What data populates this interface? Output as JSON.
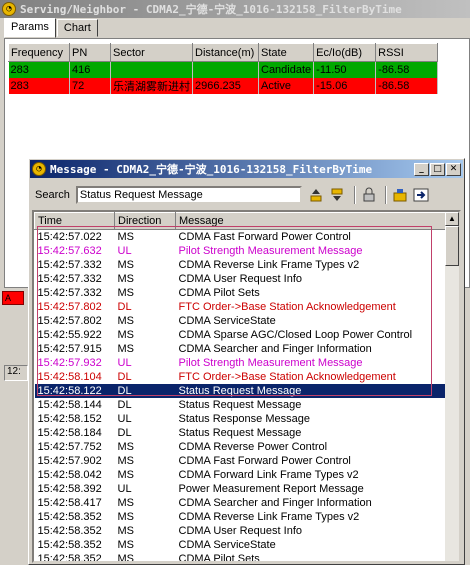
{
  "serving_window": {
    "title": "Serving/Neighbor - CDMA2_宁德-宁波_1016-132158_FilterByTime",
    "tabs": [
      "Params",
      "Chart"
    ],
    "columns": [
      "Frequency",
      "PN",
      "Sector",
      "Distance(m)",
      "State",
      "Ec/Io(dB)",
      "RSSI"
    ],
    "rows": [
      {
        "frequency": "283",
        "pn": "416",
        "sector": "",
        "distance": "",
        "state": "Candidate",
        "ecio": "-11.50",
        "rssi": "-86.58",
        "color": "#00a800"
      },
      {
        "frequency": "283",
        "pn": "72",
        "sector": "乐清湖雾新进村",
        "distance": "2966.235",
        "state": "Active",
        "ecio": "-15.06",
        "rssi": "-86.58",
        "color": "#ff0000"
      }
    ],
    "left_strip_text": "A",
    "left_box_text": "12:"
  },
  "message_window": {
    "title": "Message - CDMA2_宁德-宁波_1016-132158_FilterByTime",
    "search_label": "Search",
    "search_value": "Status Request Message",
    "columns": [
      "Time",
      "Direction",
      "Message"
    ],
    "rows": [
      {
        "time": "15:42:57.022",
        "dir": "MS",
        "msg": "CDMA Fast Forward Power Control",
        "color": "#000000"
      },
      {
        "time": "15:42:57.632",
        "dir": "UL",
        "msg": "Pilot Strength Measurement Message",
        "color": "#cc00cc"
      },
      {
        "time": "15:42:57.332",
        "dir": "MS",
        "msg": "CDMA Reverse Link Frame Types v2",
        "color": "#000000"
      },
      {
        "time": "15:42:57.332",
        "dir": "MS",
        "msg": "CDMA User Request Info",
        "color": "#000000"
      },
      {
        "time": "15:42:57.332",
        "dir": "MS",
        "msg": "CDMA Pilot Sets",
        "color": "#000000"
      },
      {
        "time": "15:42:57.802",
        "dir": "DL",
        "msg": "FTC Order->Base Station Acknowledgement",
        "color": "#cc0000"
      },
      {
        "time": "15:42:57.802",
        "dir": "MS",
        "msg": "CDMA ServiceState",
        "color": "#000000"
      },
      {
        "time": "15:42:55.922",
        "dir": "MS",
        "msg": "CDMA Sparse AGC/Closed Loop Power Control",
        "color": "#000000"
      },
      {
        "time": "15:42:57.915",
        "dir": "MS",
        "msg": "CDMA Searcher and Finger Information",
        "color": "#000000"
      },
      {
        "time": "15:42:57.932",
        "dir": "UL",
        "msg": "Pilot Strength Measurement Message",
        "color": "#cc00cc"
      },
      {
        "time": "15:42:58.104",
        "dir": "DL",
        "msg": "FTC Order->Base Station Acknowledgement",
        "color": "#cc0000"
      },
      {
        "time": "15:42:58.122",
        "dir": "DL",
        "msg": "Status Request Message",
        "color": "#000000",
        "selected": true
      },
      {
        "time": "15:42:58.144",
        "dir": "DL",
        "msg": "Status Request Message",
        "color": "#000000"
      },
      {
        "time": "15:42:58.152",
        "dir": "UL",
        "msg": "Status Response Message",
        "color": "#000000"
      },
      {
        "time": "15:42:58.184",
        "dir": "DL",
        "msg": "Status Request Message",
        "color": "#000000"
      },
      {
        "time": "15:42:57.752",
        "dir": "MS",
        "msg": "CDMA Reverse Power Control",
        "color": "#000000"
      },
      {
        "time": "15:42:57.902",
        "dir": "MS",
        "msg": "CDMA Fast Forward Power Control",
        "color": "#000000"
      },
      {
        "time": "15:42:58.042",
        "dir": "MS",
        "msg": "CDMA Forward Link Frame Types v2",
        "color": "#000000"
      },
      {
        "time": "15:42:58.392",
        "dir": "UL",
        "msg": "Power Measurement Report Message",
        "color": "#000000"
      },
      {
        "time": "15:42:58.417",
        "dir": "MS",
        "msg": "CDMA Searcher and Finger Information",
        "color": "#000000"
      },
      {
        "time": "15:42:58.352",
        "dir": "MS",
        "msg": "CDMA Reverse Link Frame Types v2",
        "color": "#000000"
      },
      {
        "time": "15:42:58.352",
        "dir": "MS",
        "msg": "CDMA User Request Info",
        "color": "#000000"
      },
      {
        "time": "15:42:58.352",
        "dir": "MS",
        "msg": "CDMA ServiceState",
        "color": "#000000"
      },
      {
        "time": "15:42:58.352",
        "dir": "MS",
        "msg": "CDMA Pilot Sets",
        "color": "#000000"
      }
    ]
  },
  "icons": {
    "toolbar": [
      "find-up-icon",
      "find-down-icon",
      "lock-icon",
      "filter-icon",
      "export-icon"
    ],
    "window_controls": [
      "minimize-icon",
      "maximize-icon",
      "close-icon"
    ]
  }
}
